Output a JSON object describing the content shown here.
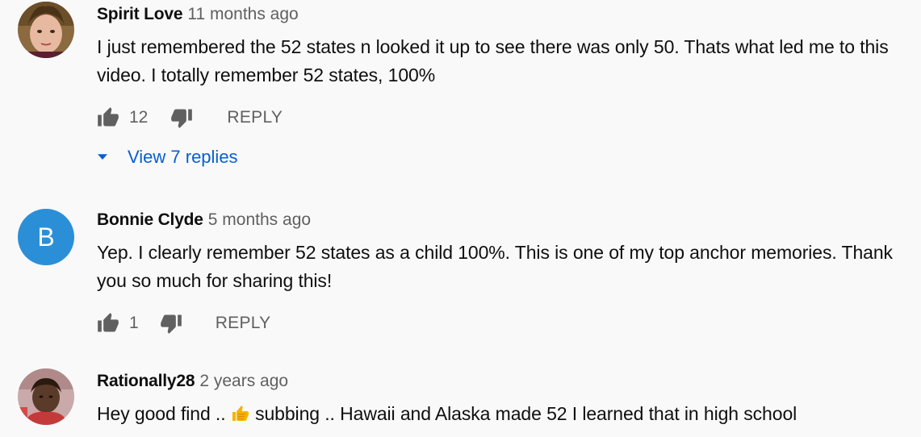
{
  "comments": [
    {
      "author": "Spirit Love",
      "time": "11 months ago",
      "avatar_icon": "profile-photo",
      "text": "I just remembered the 52 states n looked it up to see there was only 50. Thats what led me to this video. I totally remember 52 states, 100%",
      "likes": "12",
      "reply_label": "REPLY",
      "replies_label": "View 7 replies"
    },
    {
      "author": "Bonnie Clyde",
      "time": "5 months ago",
      "avatar_letter": "B",
      "avatar_color": "#2b8fd8",
      "text": "Yep. I clearly remember 52 states as a child 100%. This is one of my top anchor memories. Thank you so much for sharing this!",
      "likes": "1",
      "reply_label": "REPLY"
    },
    {
      "author": "Rationally28",
      "time": "2 years ago",
      "avatar_icon": "profile-photo",
      "text_before_emoji": "Hey good find .. ",
      "emoji": "thumbs-up-emoji",
      "text_after_emoji": " subbing .. Hawaii and Alaska made 52 I learned that in high school"
    }
  ],
  "icons": {
    "like": "thumbs-up-icon",
    "dislike": "thumbs-down-icon",
    "expand": "caret-down-icon"
  },
  "colors": {
    "background": "#f9f9f9",
    "link": "#065fd4",
    "secondary_text": "#606060",
    "icon": "#606060"
  }
}
